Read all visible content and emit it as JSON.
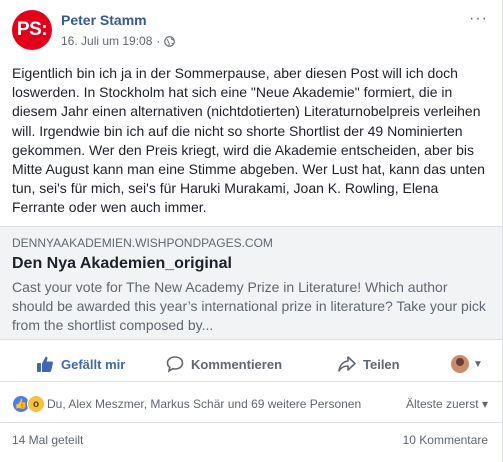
{
  "post": {
    "author": "Peter Stamm",
    "avatar_text": "PS:",
    "avatar_color": "#e2001a",
    "date": "16. Juli um 19:08",
    "separator": "·",
    "privacy_icon": "globe-icon",
    "more_label": "···",
    "text": "Eigentlich bin ich ja in der Sommerpause, aber diesen Post will ich doch loswerden. In Stockholm hat sich eine \"Neue Akademie\" formiert, die in diesem Jahr einen alternativen (nichtdotierten) Literaturnobelpreis verleihen will. Irgendwie bin ich auf die nicht so shorte Shortlist der 49 Nominierten gekommen. Wer den Preis kriegt, wird die Akademie entscheiden, aber bis Mitte August kann man eine Stimme abgeben. Wer Lust hat, kann das unten tun, sei's für mich, sei's für Haruki Murakami, Joan K. Rowling, Elena Ferrante oder wen auch immer."
  },
  "link": {
    "domain": "DENNYAAKADEMIEN.WISHPONDPAGES.COM",
    "title": "Den Nya Akademien_original",
    "description": "Cast your vote for The New Academy Prize in Literature! Which author should be awarded this year’s international prize in literature? Take your pick from the shortlist composed by..."
  },
  "actions": {
    "like_label": "Gefällt mir",
    "comment_label": "Kommentieren",
    "share_label": "Teilen",
    "like_active": true,
    "accent_color": "#4267b2"
  },
  "reactions": {
    "names": "Du, Alex Meszmer, Markus Schär und 69 weitere Personen",
    "sort_label": "Älteste zuerst ▾",
    "icons": [
      "like",
      "wow"
    ]
  },
  "footer": {
    "shares": "14 Mal geteilt",
    "comments": "10 Kommentare"
  }
}
